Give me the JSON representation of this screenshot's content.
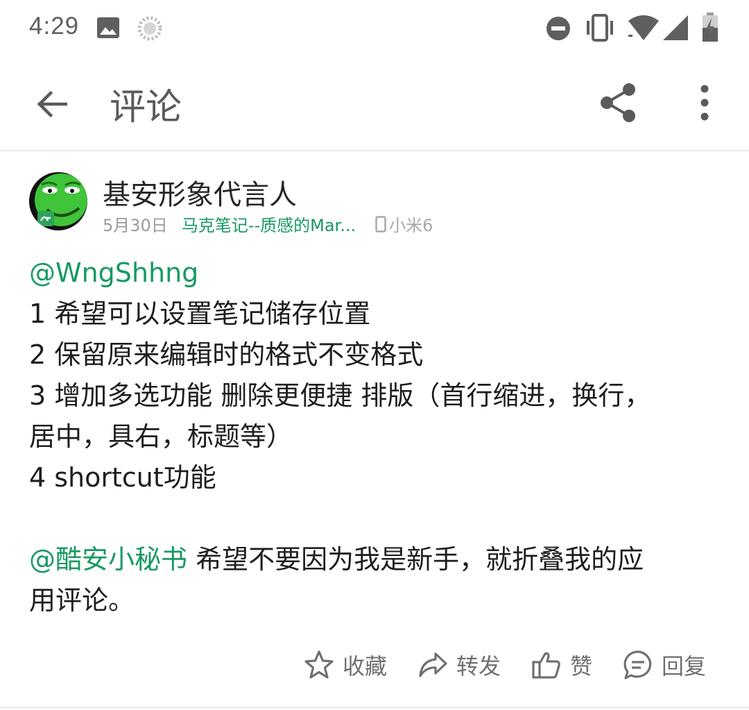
{
  "status_bar": {
    "time": "4:29",
    "icons": [
      "image-icon",
      "loading-icon",
      "do-not-disturb-icon",
      "vibrate-icon",
      "wifi-icon",
      "signal-icon",
      "battery-icon"
    ]
  },
  "app_bar": {
    "title": "评论",
    "back_icon": "arrow-back-icon",
    "share_icon": "share-icon",
    "more_icon": "more-vert-icon"
  },
  "comment": {
    "user_name": "基安形象代言人",
    "date": "5月30日",
    "app_name": "马克笔记--质感的Mar...",
    "device": "小米6",
    "lines": {
      "l0": "@WngShhng",
      "l1": "1 希望可以设置笔记储存位置",
      "l2": "2 保留原来编辑时的格式不变格式",
      "l3": "3 增加多选功能 删除更便捷 排版（首行缩进，换行，",
      "l4": "居中，具右，标题等）",
      "l5": "4 shortcut功能",
      "l7_mention": "@酷安小秘书",
      "l7_text": " 希望不要因为我是新手，就折叠我的应",
      "l8": "用评论。"
    }
  },
  "actions": {
    "favorite": "收藏",
    "forward": "转发",
    "like": "赞",
    "reply": "回复"
  },
  "colors": {
    "accent": "#179a62",
    "text": "#1e1e1e",
    "muted": "#9b9b9b",
    "icon": "#707070"
  }
}
